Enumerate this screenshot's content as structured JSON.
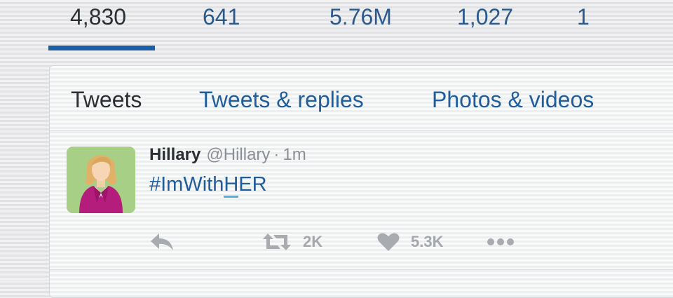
{
  "stats": [
    "4,830",
    "641",
    "5.76M",
    "1,027",
    "1"
  ],
  "tabs": [
    "Tweets",
    "Tweets & replies",
    "Photos & videos"
  ],
  "tweet": {
    "name": "Hillary",
    "handle": "@Hillary",
    "separator": "·",
    "time": "1m",
    "text_before": "#ImWith",
    "text_underlined": "H",
    "text_after": "ER",
    "retweet_count": "2K",
    "like_count": "5.3K"
  },
  "colors": {
    "link_blue": "#1f5d9c",
    "active_bar": "#1b5ea8",
    "text_dark": "#2a2f34",
    "text_gray": "#8a9097",
    "avatar_bg": "#a8cf86"
  },
  "icons": [
    "reply-icon",
    "retweet-icon",
    "heart-icon",
    "more-icon"
  ]
}
